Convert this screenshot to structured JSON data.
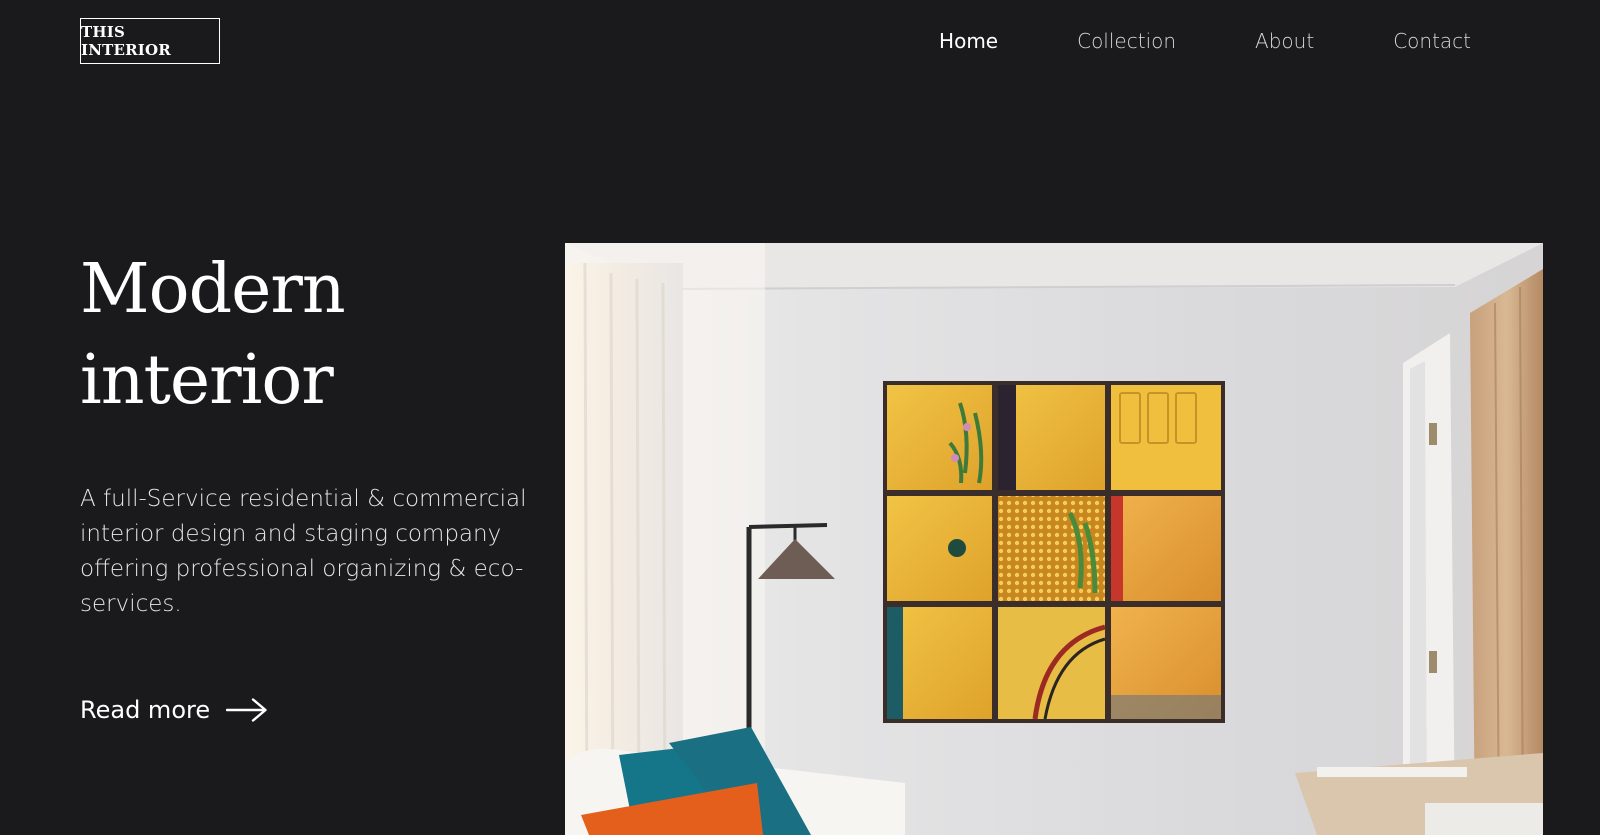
{
  "header": {
    "logo_text": "THIS INTERIOR",
    "nav": [
      {
        "label": "Home",
        "active": true
      },
      {
        "label": "Collection",
        "active": false
      },
      {
        "label": "About",
        "active": false
      },
      {
        "label": "Contact",
        "active": false
      }
    ]
  },
  "hero": {
    "title_line1": "Modern",
    "title_line2": "interior",
    "description": "A full-Service residential & commercial interior design and staging company offering professional organizing & eco-services.",
    "read_more_label": "Read more",
    "read_more_icon": "arrow-right-icon",
    "image_subject": "living-room-photo"
  },
  "colors": {
    "background": "#1a191b",
    "text": "#ffffff",
    "wall": "#dcdcdd",
    "artwork_yellow": "#e8b435",
    "pillow_teal": "#157a8a",
    "pillow_orange": "#e3641f"
  }
}
